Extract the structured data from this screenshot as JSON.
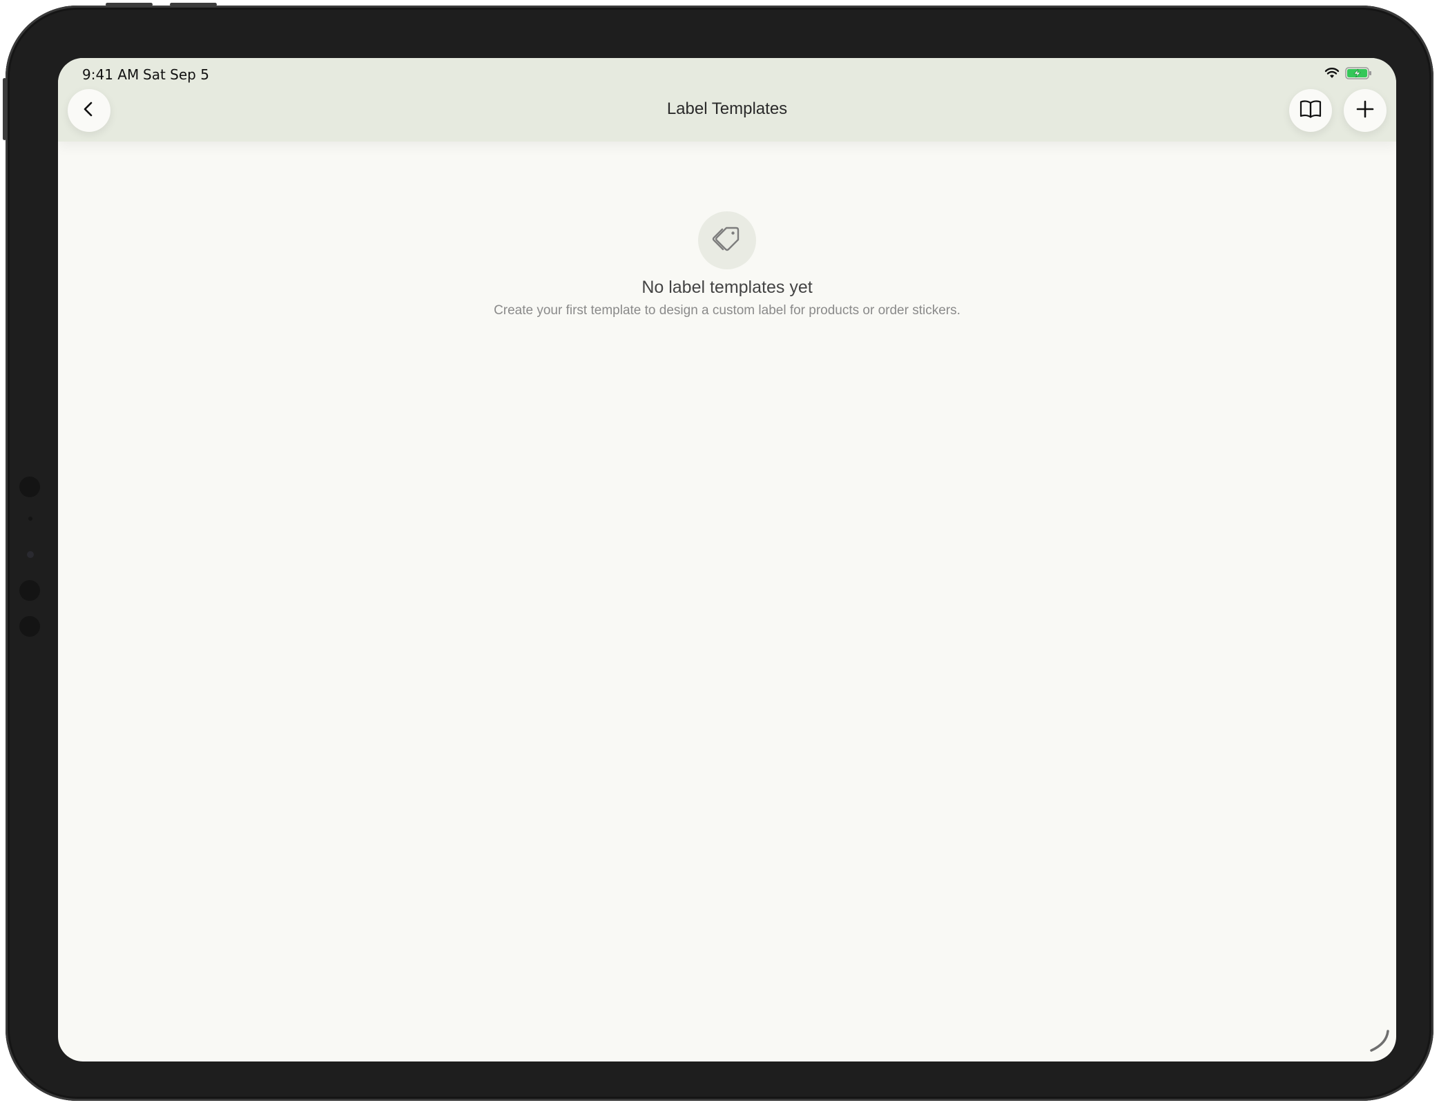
{
  "status_bar": {
    "time": "9:41 AM",
    "date": "Sat Sep 5",
    "icons": [
      "wifi-icon",
      "battery-charging-icon"
    ]
  },
  "nav_bar": {
    "title": "Label Templates",
    "left_icon": "chevron-left-icon",
    "right_icons": [
      "book-open-icon",
      "plus-icon"
    ]
  },
  "empty_state": {
    "icon": "tag-icon",
    "title": "No label templates yet",
    "subtitle": "Create your first template to design a custom label for products or order stickers."
  },
  "colors": {
    "nav_background": "#e6eadf",
    "page_background": "#f9f9f5",
    "battery_green": "#34c759"
  }
}
